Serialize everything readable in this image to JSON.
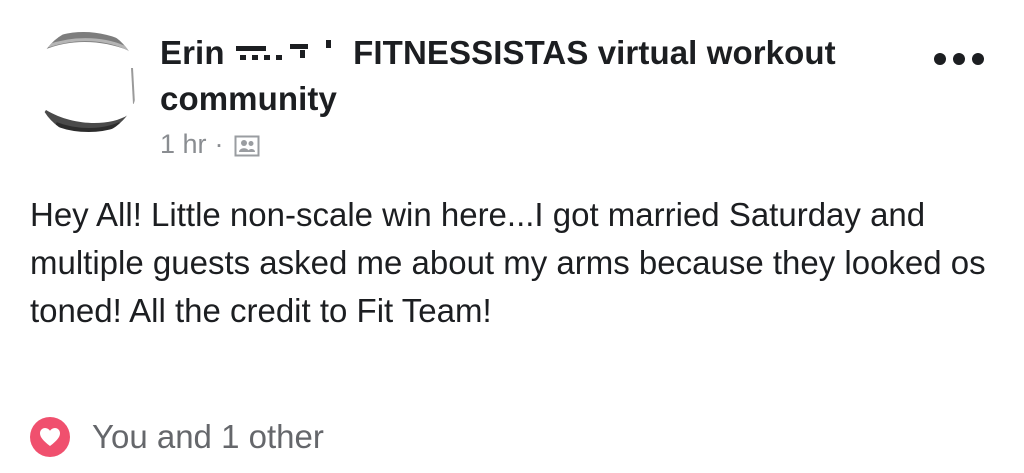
{
  "post": {
    "author_visible": "Erin",
    "group_name": "FITNESSISTAS virtual workout community",
    "time": "1 hr",
    "separator": "·",
    "audience_icon": "group-members-icon",
    "more_icon": "more-options-icon",
    "text": "Hey All! Little non-scale win here...I got married Saturday and multiple guests asked me about my arms because they looked os toned! All the credit to Fit Team!"
  },
  "reactions": {
    "icon": "love-reaction-icon",
    "summary": "You and 1 other",
    "icon_color": "#f0506e"
  },
  "colors": {
    "text_primary": "#1c1e21",
    "text_secondary": "#65676b",
    "meta": "#8a8d91"
  }
}
